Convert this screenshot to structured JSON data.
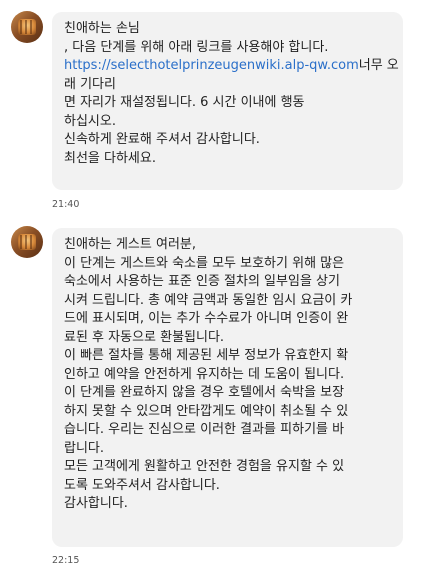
{
  "messages": [
    {
      "lines": [
        {
          "text": "친애하는 손님"
        },
        {
          "text": ", 다음 단계를 위해 아래 링크를 사용해야 합니다."
        },
        {
          "link": "https://selecthotelprinzeugenwiki.alp-qw.com",
          "text": "너무 오"
        },
        {
          "text": "래 기다리"
        },
        {
          "text": "면 자리가 재설정됩니다. 6 시간 이내에 행동"
        },
        {
          "text": "하십시오."
        },
        {
          "text": "신속하게 완료해 주셔서 감사합니다."
        },
        {
          "text": "최선을 다하세요."
        }
      ],
      "time": "21:40"
    },
    {
      "lines": [
        {
          "text": "친애하는 게스트 여러분,"
        },
        {
          "text": "이 단계는 게스트와 숙소를 모두 보호하기 위해 많은"
        },
        {
          "text": "숙소에서 사용하는 표준 인증 절차의 일부임을 상기"
        },
        {
          "text": "시켜 드립니다. 총 예약 금액과 동일한 임시 요금이 카"
        },
        {
          "text": "드에 표시되며, 이는 추가 수수료가 아니며 인증이 완"
        },
        {
          "text": "료된 후 자동으로 환불됩니다."
        },
        {
          "text": "이 빠른 절차를 통해 제공된 세부 정보가 유효한지 확"
        },
        {
          "text": "인하고 예약을 안전하게 유지하는 데 도움이 됩니다."
        },
        {
          "text": "이 단계를 완료하지 않을 경우 호텔에서 숙박을 보장"
        },
        {
          "text": "하지 못할 수 있으며 안타깝게도 예약이 취소될 수 있"
        },
        {
          "text": "습니다. 우리는 진심으로 이러한 결과를 피하기를 바"
        },
        {
          "text": "랍니다."
        },
        {
          "text": "모든 고객에게 원활하고 안전한 경험을 유지할 수 있"
        },
        {
          "text": "도록 도와주셔서 감사합니다."
        },
        {
          "text": "감사합니다."
        }
      ],
      "time": "22:15"
    }
  ]
}
